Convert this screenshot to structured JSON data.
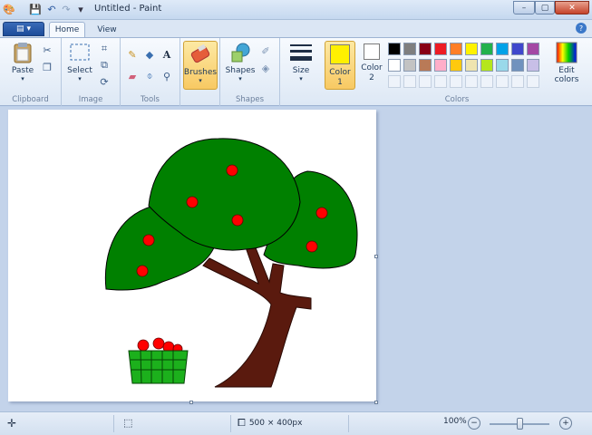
{
  "titlebar": {
    "title": "Untitled - Paint",
    "minimize": "–",
    "restore": "▢",
    "close": "✕"
  },
  "tabs": {
    "file": "▤",
    "home": "Home",
    "view": "View"
  },
  "ribbon": {
    "clipboard": {
      "label": "Clipboard",
      "paste": "Paste"
    },
    "image": {
      "label": "Image",
      "select": "Select"
    },
    "tools": {
      "label": "Tools",
      "text_tool": "A"
    },
    "brushes": {
      "label": "Brushes"
    },
    "shapes": {
      "label": "Shapes",
      "shapes_btn": "Shapes"
    },
    "size": {
      "label": "Size"
    },
    "color1": {
      "label": "Color 1",
      "value": "#FFF000"
    },
    "color2": {
      "label": "Color 2",
      "value": "#FFFFFF"
    },
    "colors": {
      "label": "Colors",
      "edit": "Edit colors",
      "row1": [
        "#000000",
        "#7F7F7F",
        "#880015",
        "#ED1C24",
        "#FF7F27",
        "#FFF200",
        "#22B14C",
        "#00A2E8",
        "#3F48CC",
        "#A349A4"
      ],
      "row2": [
        "#FFFFFF",
        "#C3C3C3",
        "#B97A57",
        "#FFAEC9",
        "#FFC90E",
        "#EFE4B0",
        "#B5E61D",
        "#99D9EA",
        "#7092BE",
        "#C8BFE7"
      ]
    }
  },
  "status": {
    "dimensions": "500 × 400px",
    "zoom": "100%"
  }
}
